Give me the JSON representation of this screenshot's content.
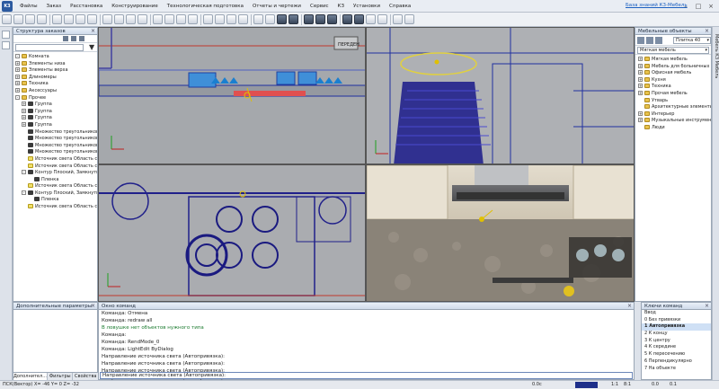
{
  "app": {
    "knowledge_base_link": "База знаний К3-Мебель"
  },
  "menu": [
    "Файлы",
    "Заказ",
    "Расстановка",
    "Конструирование",
    "Технологическая подготовка",
    "Отчеты и чертежи",
    "Сервис",
    "КЗ",
    "Установки",
    "Справка"
  ],
  "left_panel": {
    "title": "Структура заказов",
    "tree": [
      {
        "label": "Комната",
        "indent": 0,
        "icon": "folder",
        "expander": "-"
      },
      {
        "label": "Элементы низа",
        "indent": 0,
        "icon": "folder",
        "expander": "+"
      },
      {
        "label": "Элементы верха",
        "indent": 0,
        "icon": "folder",
        "expander": "+"
      },
      {
        "label": "Длиномеры",
        "indent": 0,
        "icon": "folder",
        "expander": "+"
      },
      {
        "label": "Техника",
        "indent": 0,
        "icon": "folder",
        "expander": "+"
      },
      {
        "label": "Аксессуары",
        "indent": 0,
        "icon": "folder",
        "expander": "+"
      },
      {
        "label": "Прочее",
        "indent": 0,
        "icon": "folder",
        "expander": "-"
      },
      {
        "label": "Группа",
        "indent": 1,
        "icon": "item",
        "expander": "+"
      },
      {
        "label": "Группа",
        "indent": 1,
        "icon": "item",
        "expander": "+"
      },
      {
        "label": "Группа",
        "indent": 1,
        "icon": "item",
        "expander": "+"
      },
      {
        "label": "Группа",
        "indent": 1,
        "icon": "item",
        "expander": "+"
      },
      {
        "label": "Множество треугольников",
        "indent": 1,
        "icon": "item",
        "expander": ""
      },
      {
        "label": "Множество треугольников",
        "indent": 1,
        "icon": "item",
        "expander": ""
      },
      {
        "label": "Множество треугольников",
        "indent": 1,
        "icon": "item",
        "expander": ""
      },
      {
        "label": "Множество треугольников",
        "indent": 1,
        "icon": "item",
        "expander": ""
      },
      {
        "label": "Источник света Область свет...",
        "indent": 1,
        "icon": "light",
        "expander": ""
      },
      {
        "label": "Источник света Область свет...",
        "indent": 1,
        "icon": "light",
        "expander": ""
      },
      {
        "label": "Контур Плоский, Замкнутый, ...",
        "indent": 1,
        "icon": "item",
        "expander": "-"
      },
      {
        "label": "Пленка",
        "indent": 2,
        "icon": "item",
        "expander": ""
      },
      {
        "label": "Источник света Область свет...",
        "indent": 1,
        "icon": "light",
        "expander": ""
      },
      {
        "label": "Контур Плоский, Замкнутый, ...",
        "indent": 1,
        "icon": "item",
        "expander": "-"
      },
      {
        "label": "Пленка",
        "indent": 2,
        "icon": "item",
        "expander": ""
      },
      {
        "label": "Источник света Область свет...",
        "indent": 1,
        "icon": "light",
        "expander": ""
      }
    ]
  },
  "params_panel": {
    "title": "Дополнительные параметры",
    "tabs": [
      "Дополнител...",
      "Фильтры",
      "Свойства"
    ]
  },
  "command_window": {
    "title": "Окно команд",
    "lines": [
      {
        "text": "Команда: Отмена",
        "kind": "normal"
      },
      {
        "text": "Команда: redraw all",
        "kind": "normal"
      },
      {
        "text": "В ловушке нет объектов нужного типа",
        "kind": "ok"
      },
      {
        "text": "Команда:",
        "kind": "normal"
      },
      {
        "text": "Команда: RendMode_0",
        "kind": "normal"
      },
      {
        "text": "Команда: LightEdit ByDialog",
        "kind": "normal"
      },
      {
        "text": "Направление источника света (Автопривязка):",
        "kind": "normal"
      },
      {
        "text": "Направление источника света (Автопривязка):",
        "kind": "normal"
      },
      {
        "text": "Направление источника света (Автопривязка):",
        "kind": "normal"
      },
      {
        "text": "Направление источника света (Автопривязка):",
        "kind": "normal"
      }
    ],
    "input_value": "Направление источника света (Автопривязка):"
  },
  "right_panel": {
    "title": "Мебельные объекты",
    "dropdown_value": "Плитка 40",
    "dropdown_value2": "",
    "section_label": "Мягкая мебель",
    "tree": [
      {
        "label": "Мягкая мебель",
        "expander": "+"
      },
      {
        "label": "Мебель для больничных пала...",
        "expander": "+"
      },
      {
        "label": "Офисная мебель",
        "expander": "+"
      },
      {
        "label": "Кухня",
        "expander": "+"
      },
      {
        "label": "Техника",
        "expander": "+"
      },
      {
        "label": "Прочая мебель",
        "expander": "+"
      },
      {
        "label": "Утварь",
        "expander": ""
      },
      {
        "label": "Архитектурные элементы",
        "expander": ""
      },
      {
        "label": "Интерьер",
        "expander": "+"
      },
      {
        "label": "Музыкальные инструменты",
        "expander": "+"
      },
      {
        "label": "Люди",
        "expander": ""
      }
    ],
    "side_tab": "Мебель КЗ Мебель"
  },
  "snap_panel": {
    "title": "Ключи команд",
    "items": [
      {
        "text": "Ввод",
        "selected": false
      },
      {
        "text": "0  Без привязки",
        "selected": false
      },
      {
        "text": "1  Автопривязка",
        "selected": true
      },
      {
        "text": "2  К концу",
        "selected": false
      },
      {
        "text": "3  К центру",
        "selected": false
      },
      {
        "text": "4  К середине",
        "selected": false
      },
      {
        "text": "5  К пересечению",
        "selected": false
      },
      {
        "text": "6  Перпендикулярно",
        "selected": false
      },
      {
        "text": "7  На объекте",
        "selected": false
      }
    ]
  },
  "status": {
    "coords": "ПСК(Вектор) X= -46   Y= 0   Z= -32",
    "scale1": "0.0c",
    "scale2": "0.1",
    "ratio1": "1:1",
    "ratio2": "8:1",
    "val": "0.0"
  },
  "viewports": {
    "label_stop": "ПЕРЕДЕН"
  }
}
